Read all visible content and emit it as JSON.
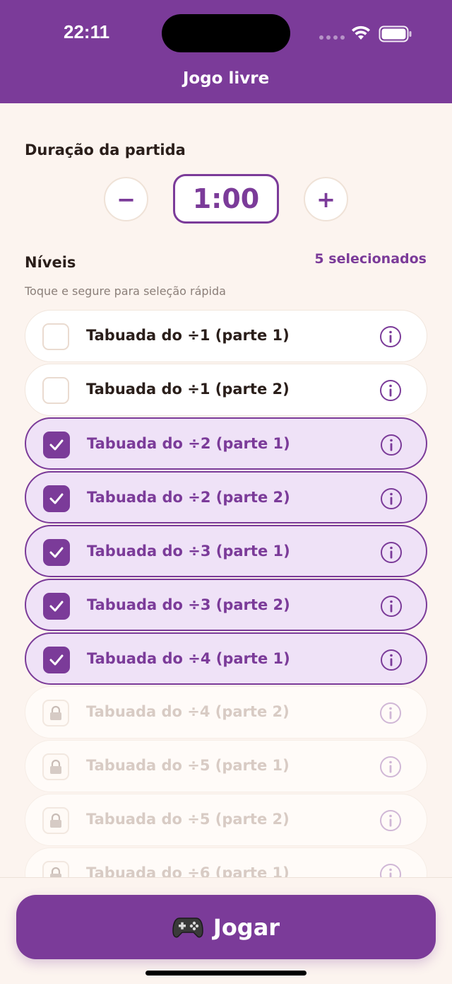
{
  "status_bar": {
    "time": "22:11"
  },
  "header": {
    "title": "Jogo livre"
  },
  "duration": {
    "label": "Duração da partida",
    "value": "1:00",
    "decrement": "−",
    "increment": "+"
  },
  "levels": {
    "label": "Níveis",
    "selected_count": "5 selecionados",
    "hint": "Toque e segure para seleção rápida",
    "items": [
      {
        "label": "Tabuada do ÷1 (parte 1)",
        "state": "unchecked"
      },
      {
        "label": "Tabuada do ÷1 (parte 2)",
        "state": "unchecked"
      },
      {
        "label": "Tabuada do ÷2 (parte 1)",
        "state": "selected"
      },
      {
        "label": "Tabuada do ÷2 (parte 2)",
        "state": "selected"
      },
      {
        "label": "Tabuada do ÷3 (parte 1)",
        "state": "selected"
      },
      {
        "label": "Tabuada do ÷3 (parte 2)",
        "state": "selected"
      },
      {
        "label": "Tabuada do ÷4 (parte 1)",
        "state": "selected"
      },
      {
        "label": "Tabuada do ÷4 (parte 2)",
        "state": "locked"
      },
      {
        "label": "Tabuada do ÷5 (parte 1)",
        "state": "locked"
      },
      {
        "label": "Tabuada do ÷5 (parte 2)",
        "state": "locked"
      },
      {
        "label": "Tabuada do ÷6 (parte 1)",
        "state": "locked"
      }
    ]
  },
  "play_button": {
    "icon": "game-controller-icon",
    "label": "Jogar"
  },
  "colors": {
    "accent": "#7b3b99",
    "background": "#fcf4ef",
    "selected_bg": "#efe2f7"
  }
}
